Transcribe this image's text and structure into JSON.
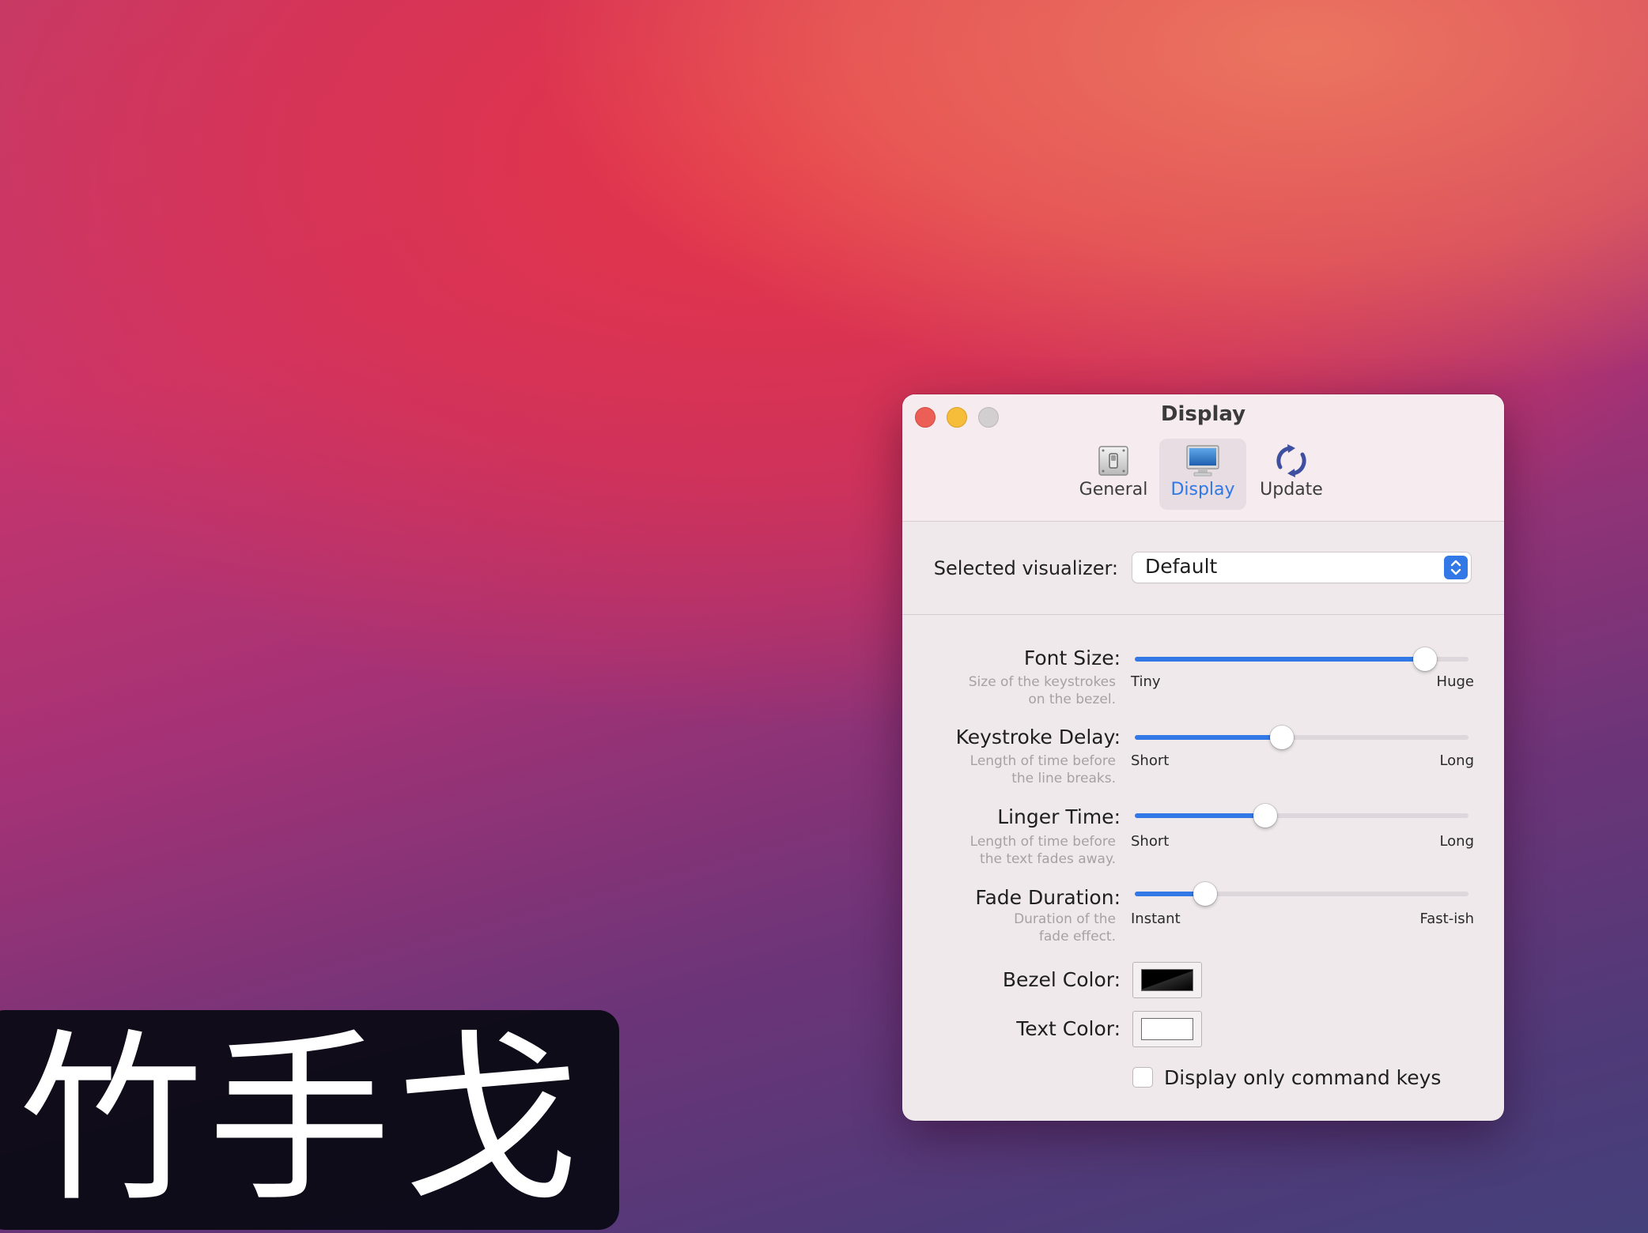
{
  "window": {
    "title": "Display"
  },
  "toolbar": {
    "tabs": [
      {
        "label": "General",
        "icon": "switch-icon"
      },
      {
        "label": "Display",
        "icon": "monitor-icon",
        "selected": true
      },
      {
        "label": "Update",
        "icon": "refresh-icon"
      }
    ]
  },
  "visualizer": {
    "label": "Selected visualizer:",
    "value": "Default"
  },
  "sliders": [
    {
      "label": "Font Size:",
      "desc_line1": "Size of the keystrokes",
      "desc_line2": "on the bezel.",
      "min_label": "Tiny",
      "max_label": "Huge",
      "value": 0.87
    },
    {
      "label": "Keystroke Delay:",
      "desc_line1": "Length of time before",
      "desc_line2": "the line breaks.",
      "min_label": "Short",
      "max_label": "Long",
      "value": 0.44
    },
    {
      "label": "Linger Time:",
      "desc_line1": "Length of time before",
      "desc_line2": "the text fades away.",
      "min_label": "Short",
      "max_label": "Long",
      "value": 0.39
    },
    {
      "label": "Fade Duration:",
      "desc_line1": "Duration of the",
      "desc_line2": "fade effect.",
      "min_label": "Instant",
      "max_label": "Fast-ish",
      "value": 0.21
    }
  ],
  "colors": {
    "bezel_label": "Bezel Color:",
    "bezel_color": "#000000",
    "text_label": "Text Color:",
    "text_color": "#ffffff",
    "accent": "#3278e6"
  },
  "checkbox": {
    "label": "Display only command keys",
    "checked": false
  },
  "bezel": {
    "text": "竹手戈"
  }
}
